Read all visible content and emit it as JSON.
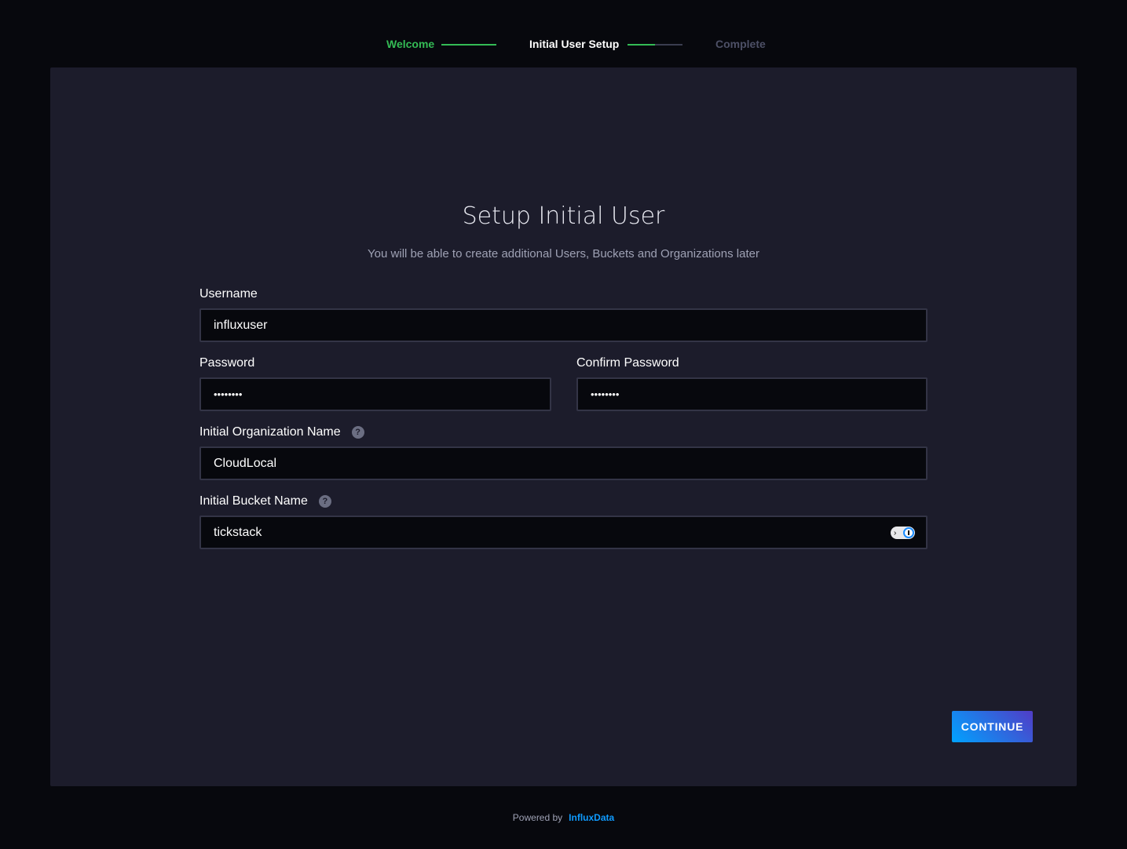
{
  "wizard": {
    "steps": [
      {
        "label": "Welcome",
        "state": "done"
      },
      {
        "label": "Initial User Setup",
        "state": "current"
      },
      {
        "label": "Complete",
        "state": "pending"
      }
    ],
    "colors": {
      "done": "#34bb55",
      "current": "#ffffff",
      "pending": "#4d5066"
    }
  },
  "form": {
    "title": "Setup Initial User",
    "subtitle": "You will be able to create additional Users, Buckets and Organizations later",
    "username_label": "Username",
    "username_value": "influxuser",
    "password_label": "Password",
    "password_value": "••••••••",
    "confirm_label": "Confirm Password",
    "confirm_value": "••••••••",
    "org_label": "Initial Organization Name",
    "org_value": "CloudLocal",
    "bucket_label": "Initial Bucket Name",
    "bucket_value": "tickstack",
    "help_glyph": "?",
    "continue_label": "CONTINUE"
  },
  "footer": {
    "powered_by": "Powered by",
    "brand": "InfluxData"
  }
}
